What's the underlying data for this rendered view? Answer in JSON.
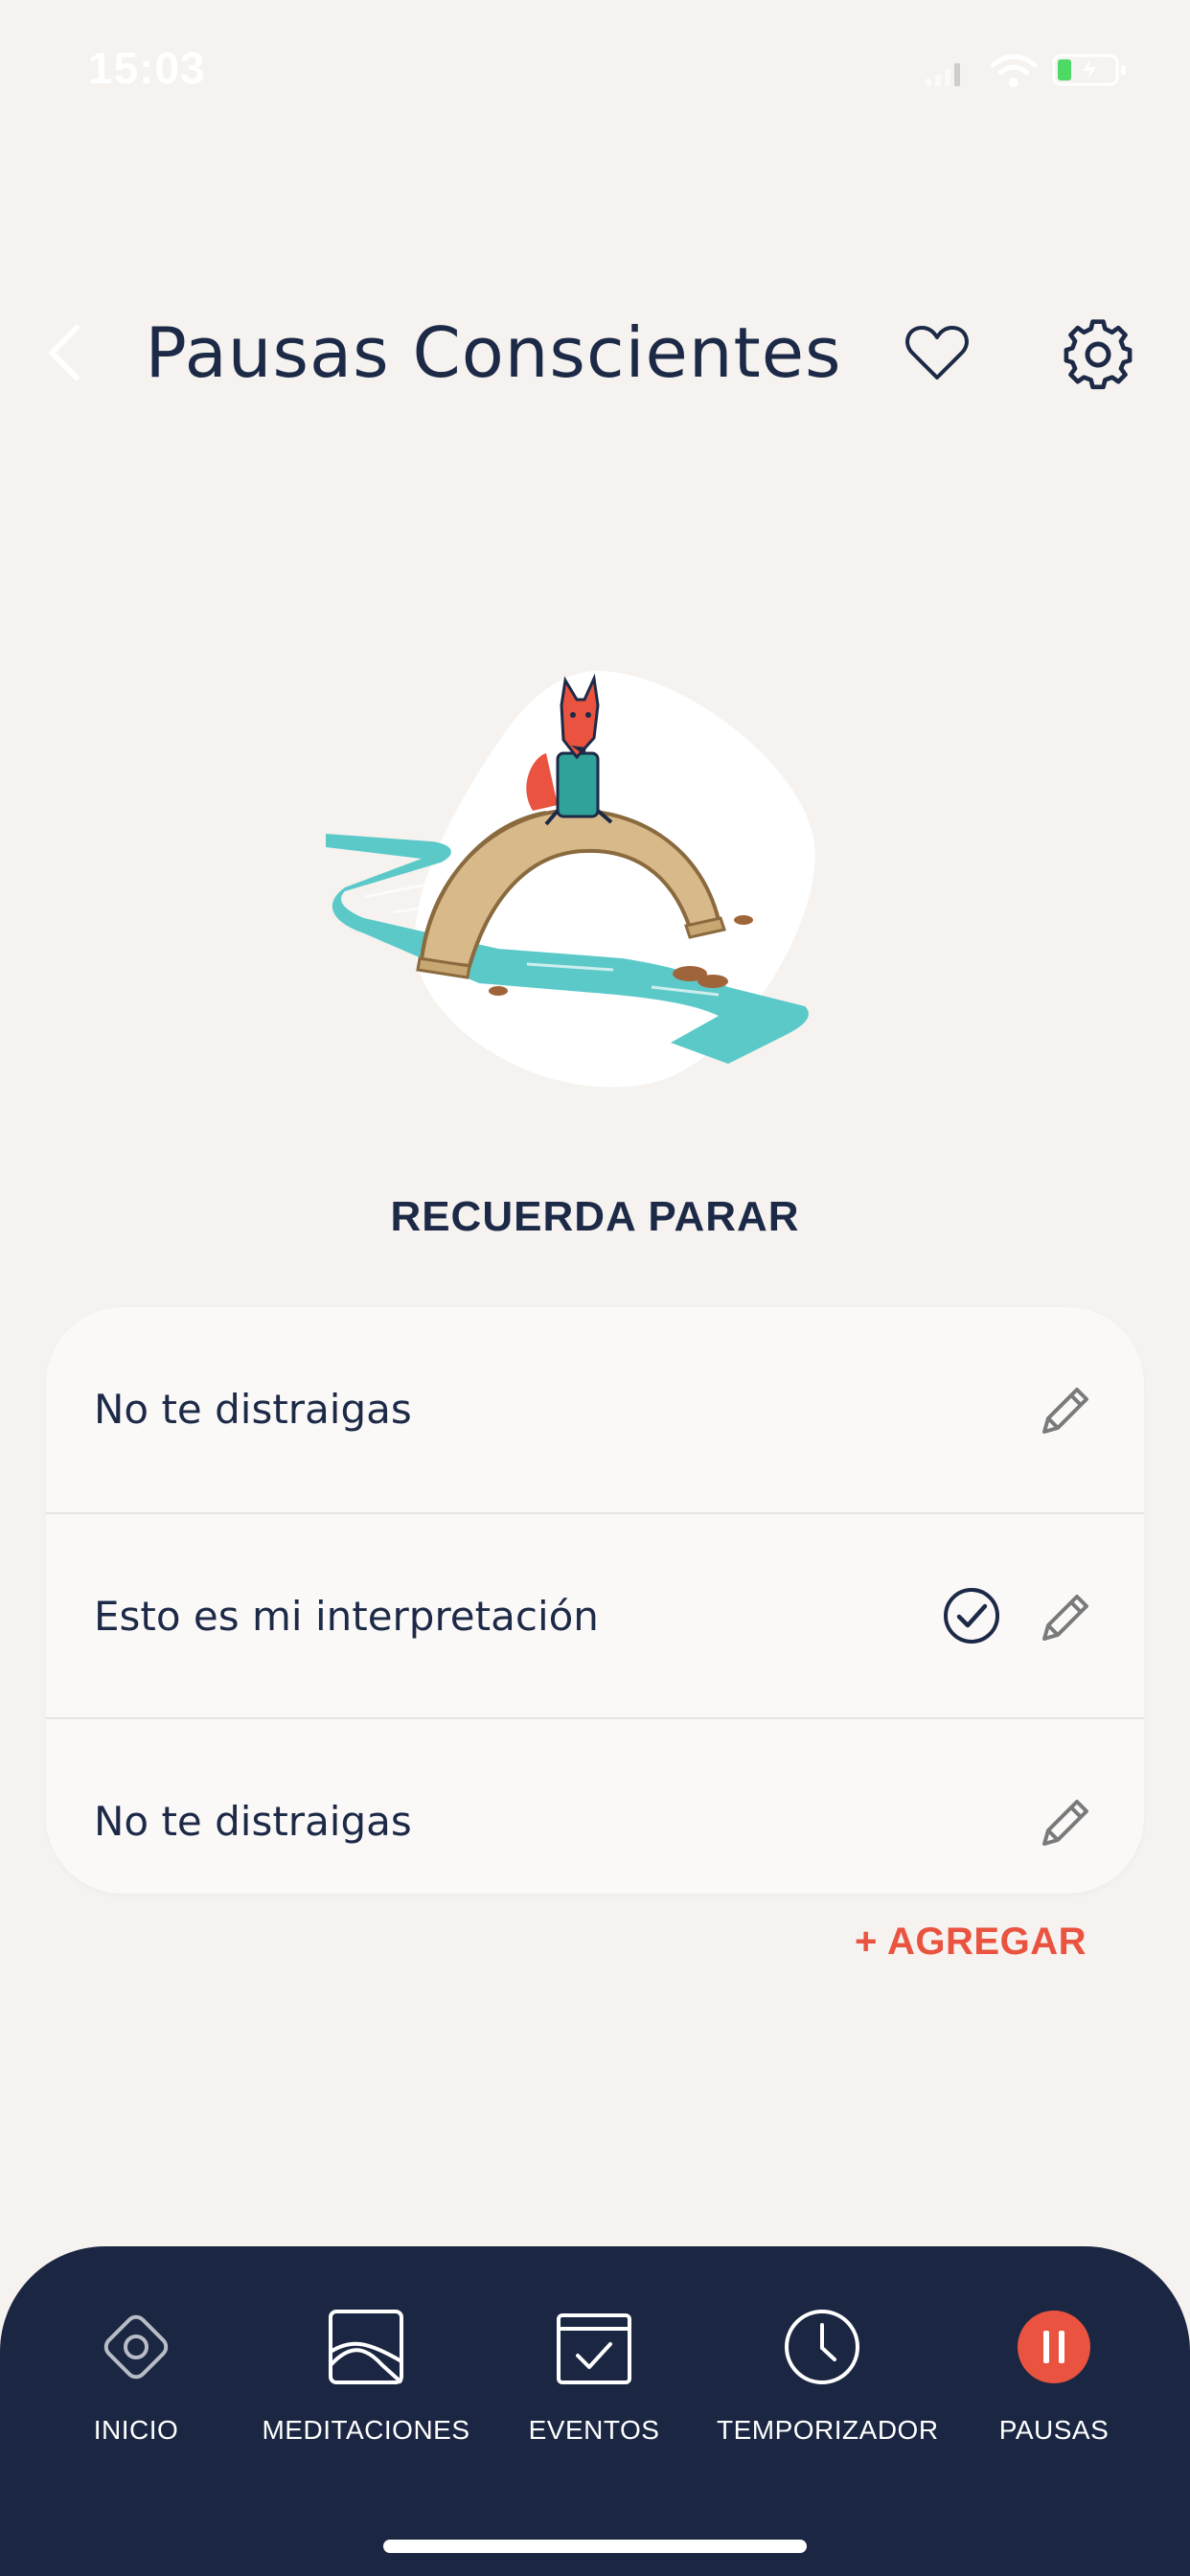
{
  "status_bar": {
    "time": "15:03"
  },
  "header": {
    "title": "Pausas Conscientes",
    "back_icon": "chevron-left-icon",
    "favorite_icon": "heart-icon",
    "settings_icon": "gear-icon"
  },
  "illustration": {
    "subject": "fox-on-bridge-illustration"
  },
  "section": {
    "title": "RECUERDA PARAR"
  },
  "reminders": [
    {
      "label": "No te distraigas",
      "selected": false
    },
    {
      "label": "Esto es mi interpretación",
      "selected": true
    },
    {
      "label": "No te distraigas",
      "selected": false
    }
  ],
  "add_label": "+ AGREGAR",
  "nav": {
    "items": [
      {
        "label": "INICIO",
        "icon": "eye-diamond-icon",
        "active": false
      },
      {
        "label": "MEDITACIONES",
        "icon": "image-icon",
        "active": false
      },
      {
        "label": "EVENTOS",
        "icon": "calendar-check-icon",
        "active": false
      },
      {
        "label": "TEMPORIZADOR",
        "icon": "clock-icon",
        "active": false
      },
      {
        "label": "PAUSAS",
        "icon": "pause-icon",
        "active": true
      }
    ]
  },
  "colors": {
    "background": "#f5f2ef",
    "navy": "#1d2a47",
    "accent": "#e9533f",
    "tabbar": "#1b2642"
  }
}
